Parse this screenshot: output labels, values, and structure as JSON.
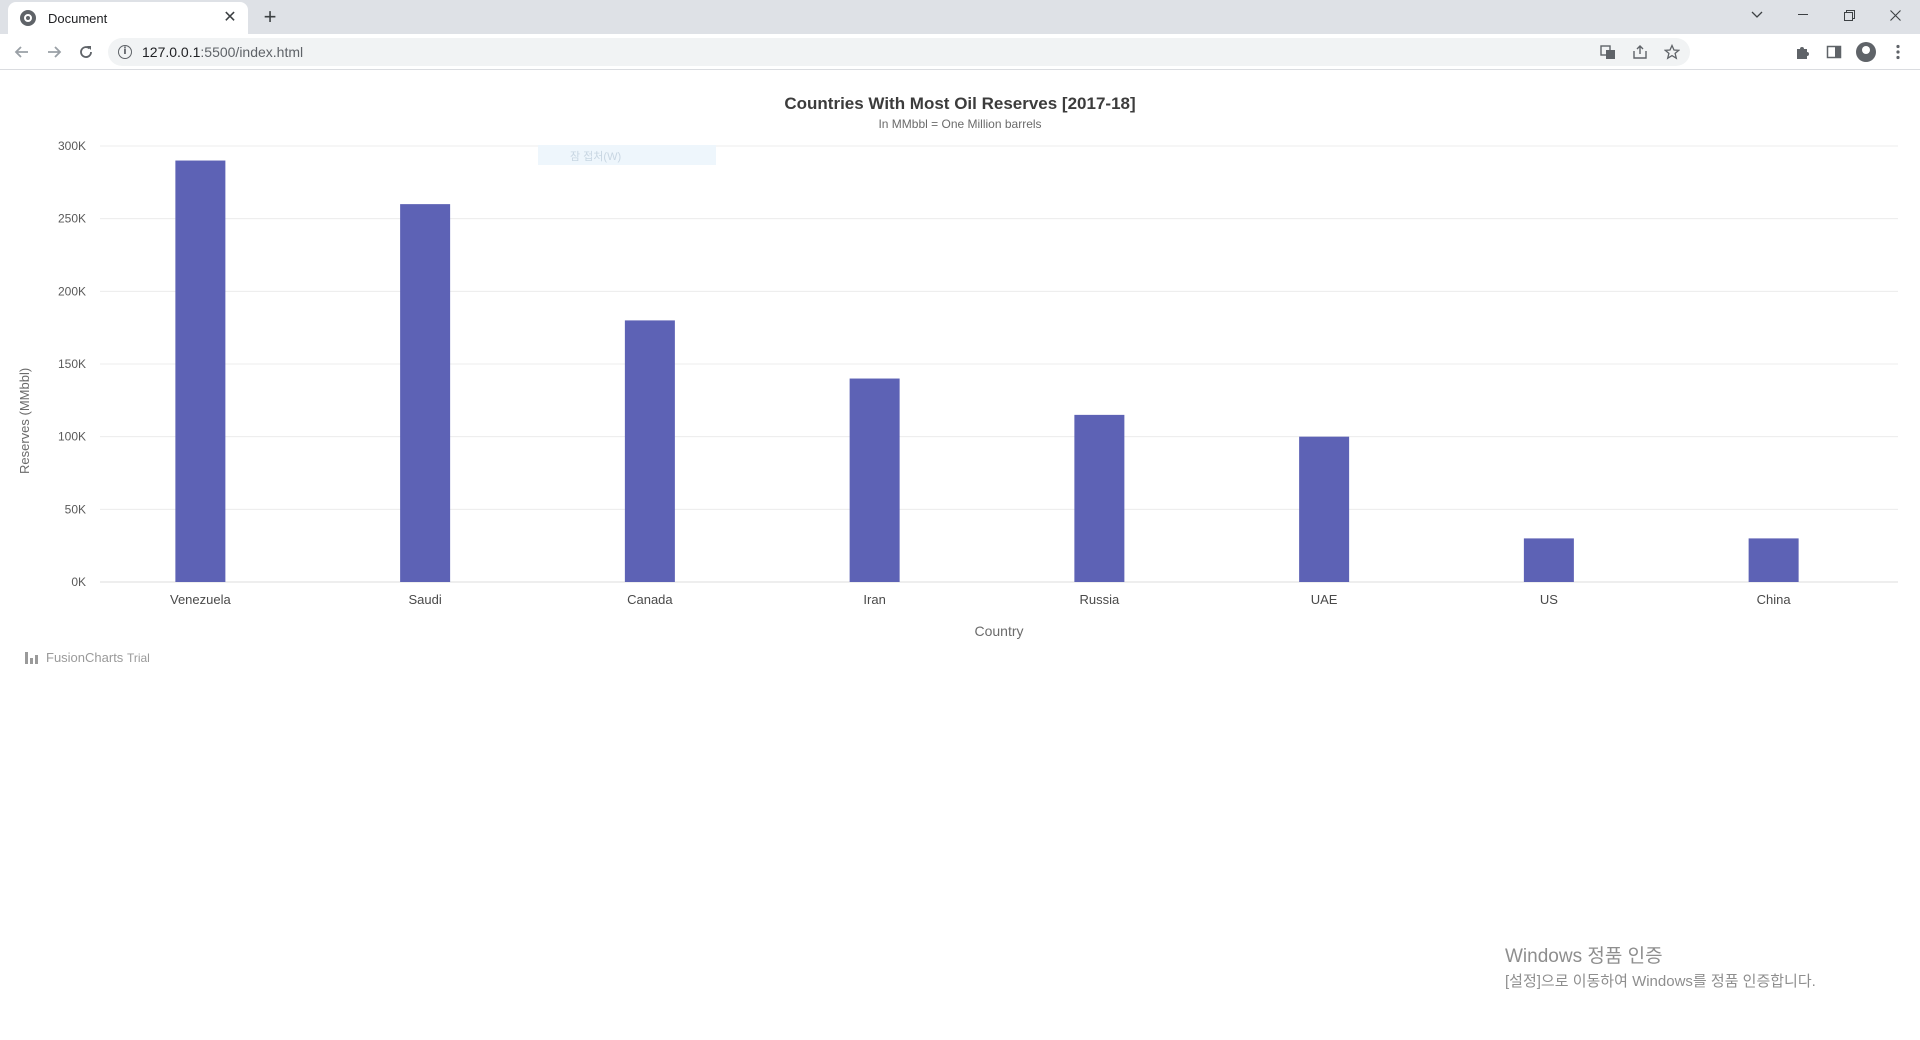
{
  "browser": {
    "tab_title": "Document",
    "tab_close": "✕",
    "new_tab": "+",
    "url_host": "127.0.0.1",
    "url_rest": ":5500/index.html"
  },
  "chart_data": {
    "type": "bar",
    "title": "Countries With Most Oil Reserves [2017-18]",
    "subtitle": "In MMbbl = One Million barrels",
    "xlabel": "Country",
    "ylabel": "Reserves (MMbbl)",
    "categories": [
      "Venezuela",
      "Saudi",
      "Canada",
      "Iran",
      "Russia",
      "UAE",
      "US",
      "China"
    ],
    "values": [
      290000,
      260000,
      180000,
      140000,
      115000,
      100000,
      30000,
      30000
    ],
    "ylim": [
      0,
      300000
    ],
    "yticks": [
      0,
      50000,
      100000,
      150000,
      200000,
      250000,
      300000
    ],
    "ytick_labels": [
      "0K",
      "50K",
      "100K",
      "150K",
      "200K",
      "250K",
      "300K"
    ],
    "grid": true,
    "bar_color": "#5d62b5"
  },
  "overlay": {
    "ghost_menu_text": "잠 접처(W)"
  },
  "fusioncharts": {
    "brand": "FusionCharts",
    "trial": "Trial"
  },
  "watermark": {
    "title": "Windows 정품 인증",
    "subtitle": "[설정]으로 이동하여 Windows를 정품 인증합니다."
  }
}
